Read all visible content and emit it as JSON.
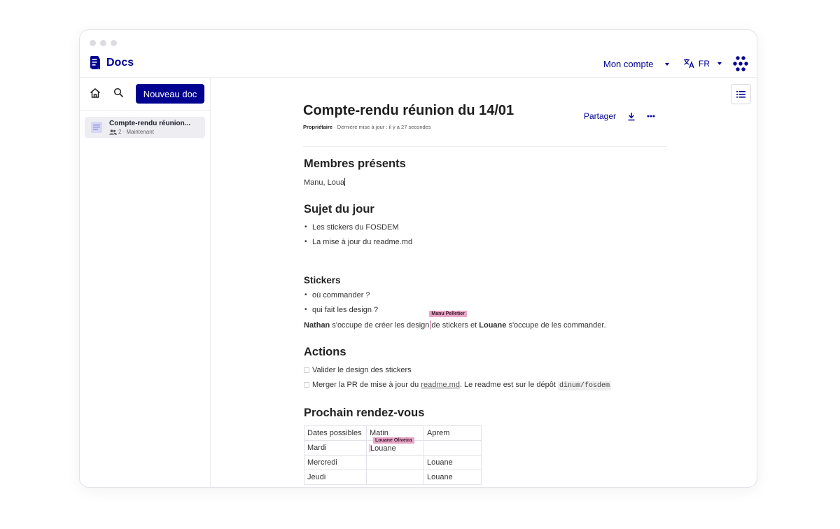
{
  "app": {
    "name": "Docs"
  },
  "header": {
    "account_label": "Mon compte",
    "lang_label": "FR"
  },
  "sidebar": {
    "new_doc_label": "Nouveau doc",
    "doc": {
      "title": "Compte-rendu réunion...",
      "members": "2",
      "updated": "· Maintenant"
    }
  },
  "document": {
    "title": "Compte-rendu réunion du 14/01",
    "role": "Propriétaire",
    "updated": " · Dernière mise à jour : il y a 27 secondes",
    "share_label": "Partager",
    "members": {
      "heading": "Membres présents",
      "text": "Manu, Loua"
    },
    "topic": {
      "heading": "Sujet du jour",
      "items": [
        "Les stickers du FOSDEM",
        "La mise à jour du readme.md"
      ]
    },
    "stickers": {
      "heading": "Stickers",
      "items": [
        "où commander ?",
        "qui fait les design ?"
      ],
      "sentence": {
        "name1": "Nathan",
        "part1": " s'occupe de créer les design",
        "part2": "de stickers et ",
        "name2": "Louane",
        "part3": " s'occupe de les commander."
      }
    },
    "actions": {
      "heading": "Actions",
      "task1": "Valider le design des stickers",
      "task2_pre": "Merger la PR de mise à jour du ",
      "task2_link": "readme.md",
      "task2_post": ". Le readme est sur le dépôt ",
      "task2_code": "dinum/fosdem"
    },
    "next_meeting": {
      "heading": "Prochain rendez-vous",
      "header_row": [
        "Dates possibles",
        "Matin",
        "Aprem"
      ],
      "rows": [
        [
          "Mardi",
          "Louane",
          ""
        ],
        [
          "Mercredi",
          "",
          "Louane"
        ],
        [
          "Jeudi",
          "",
          "Louane"
        ]
      ]
    }
  },
  "collaborators": [
    {
      "name": "Manu Pelletier",
      "color": "#e8a6c7"
    },
    {
      "name": "Louane Oliveira",
      "color": "#e8a6c7"
    }
  ],
  "colors": {
    "brand": "#000091",
    "cursor": "#cc4d8a"
  },
  "icons": {
    "app_logo": "document-logo-icon",
    "home": "home-icon",
    "search": "search-icon",
    "translate": "translate-icon",
    "gouv": "gouv-grid-icon",
    "toc": "table-of-contents-icon",
    "download": "download-icon",
    "more": "more-icon",
    "members": "people-icon"
  }
}
